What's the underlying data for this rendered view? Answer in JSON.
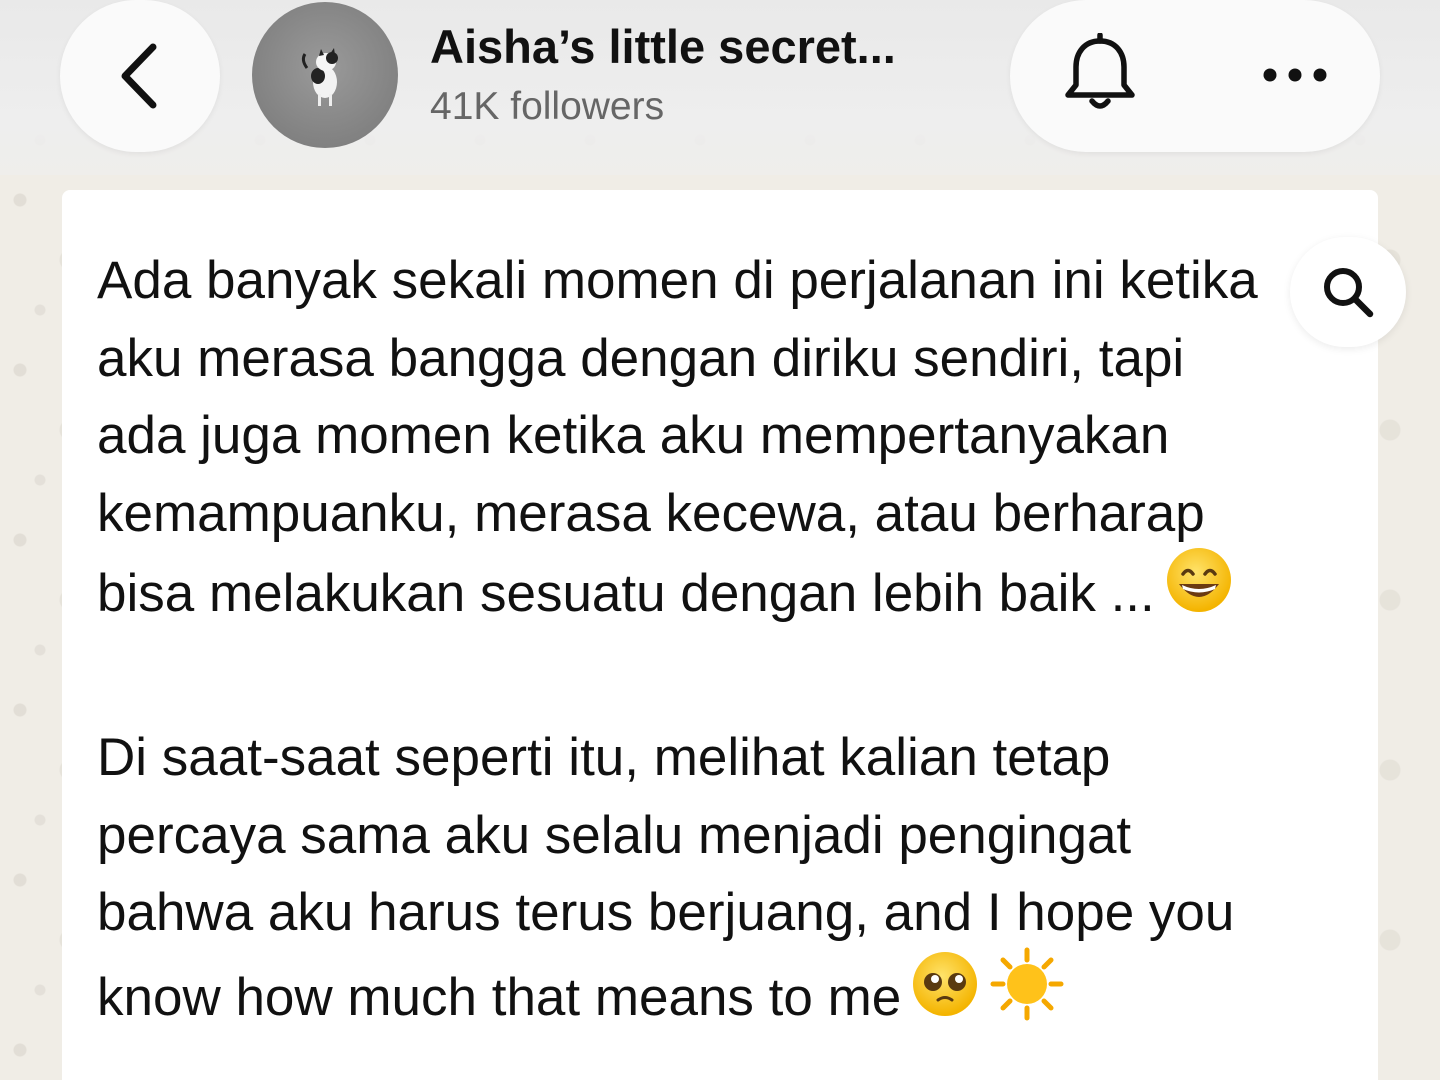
{
  "header": {
    "channel_name": "Aisha’s little secret...",
    "followers": "41K followers"
  },
  "icons": {
    "back": "chevron-left-icon",
    "bell": "bell-icon",
    "more": "more-horizontal-icon",
    "search": "search-icon"
  },
  "message": {
    "paragraph_1": "Ada banyak sekali momen di perjalanan ini ketika aku merasa bangga dengan diriku sendiri, tapi ada juga momen ketika aku mempertanyakan kemampuanku, merasa kecewa, atau berharap bisa melakukan sesuatu dengan lebih baik ...",
    "paragraph_1_emoji": "grinning-face-with-smiling-eyes",
    "paragraph_2": "Di saat-saat seperti itu, melihat kalian tetap percaya sama aku selalu menjadi pengingat bahwa aku harus terus berjuang, and I hope you know how much that means to me",
    "paragraph_2_emojis": [
      "pleading-face",
      "sun"
    ]
  },
  "colors": {
    "background": "#efeae2",
    "bubble": "#ffffff",
    "text": "#111111",
    "secondary_text": "#666666"
  }
}
